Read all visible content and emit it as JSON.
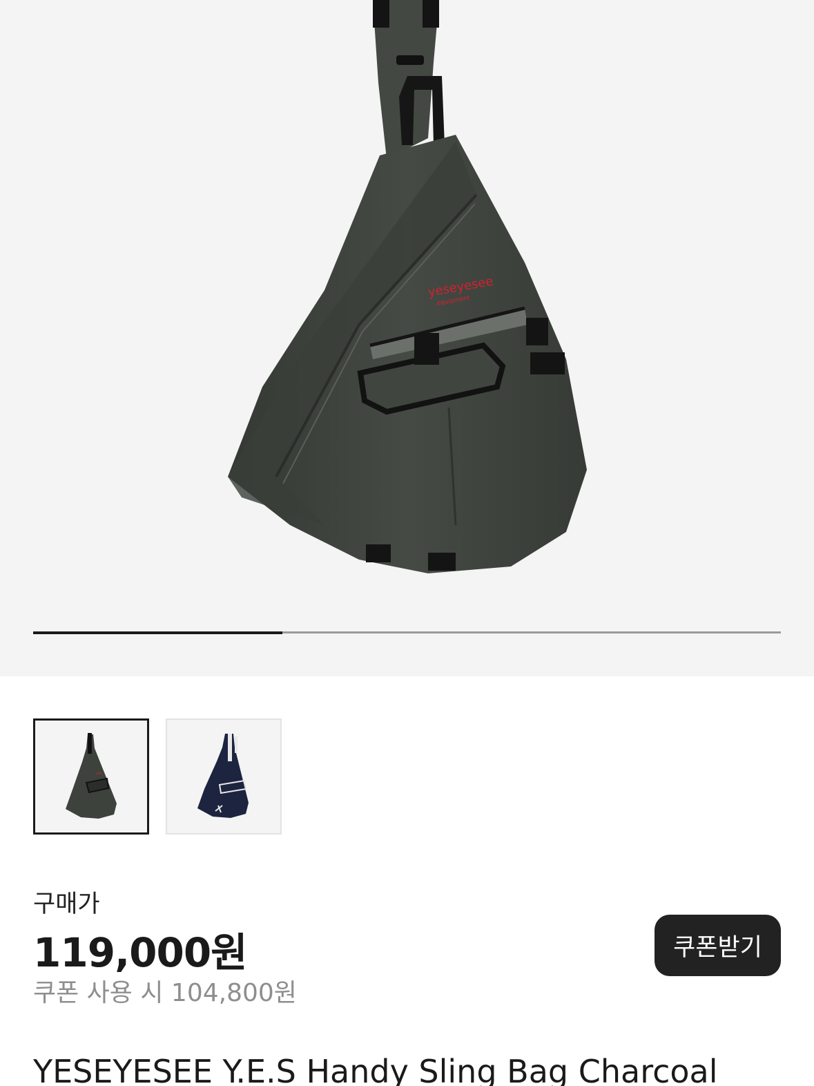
{
  "product": {
    "image_alt": "YESEYESEE Y.E.S Handy Sling Bag Charcoal",
    "logo_text": "yeseyesee",
    "logo_sub": "equipment",
    "gallery_progress": 0.333,
    "thumbnails": [
      {
        "name": "charcoal",
        "selected": true,
        "color": "#3e423d"
      },
      {
        "name": "navy",
        "selected": false,
        "color": "#1c2440"
      }
    ],
    "price_label": "구매가",
    "price": "119,000원",
    "coupon_price": "쿠폰 사용 시 104,800원",
    "coupon_button": "쿠폰받기",
    "title": "YESEYESEE Y.E.S Handy Sling Bag Charcoal"
  },
  "colors": {
    "hero_bg": "#f4f4f4",
    "bag_body": "#3f433e",
    "logo_red": "#d3222f",
    "button_bg": "#222222"
  }
}
